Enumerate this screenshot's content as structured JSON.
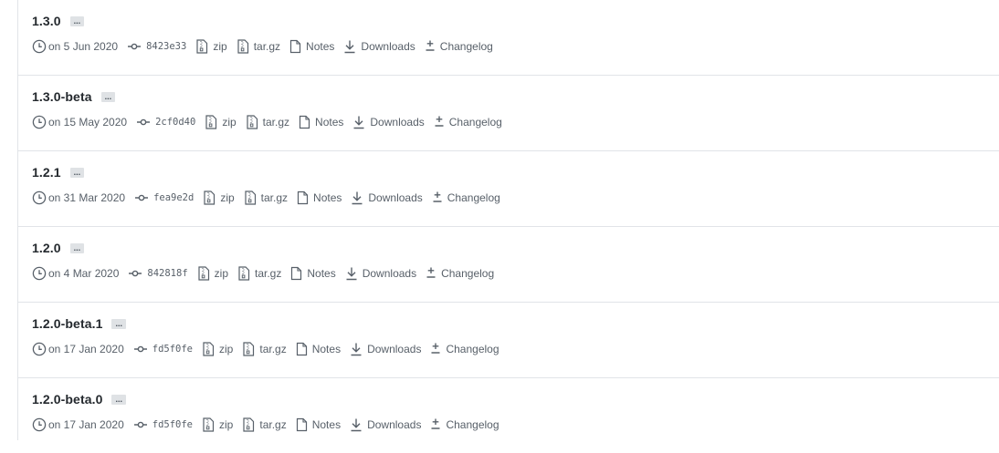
{
  "releases": [
    {
      "tag": "1.3.0",
      "ellipsis": "...",
      "date": "on 5 Jun 2020",
      "sha": "8423e33",
      "zip": "zip",
      "targz": "tar.gz",
      "notes": "Notes",
      "downloads": "Downloads",
      "changelog": "Changelog"
    },
    {
      "tag": "1.3.0-beta",
      "ellipsis": "...",
      "date": "on 15 May 2020",
      "sha": "2cf0d40",
      "zip": "zip",
      "targz": "tar.gz",
      "notes": "Notes",
      "downloads": "Downloads",
      "changelog": "Changelog"
    },
    {
      "tag": "1.2.1",
      "ellipsis": "...",
      "date": "on 31 Mar 2020",
      "sha": "fea9e2d",
      "zip": "zip",
      "targz": "tar.gz",
      "notes": "Notes",
      "downloads": "Downloads",
      "changelog": "Changelog"
    },
    {
      "tag": "1.2.0",
      "ellipsis": "...",
      "date": "on 4 Mar 2020",
      "sha": "842818f",
      "zip": "zip",
      "targz": "tar.gz",
      "notes": "Notes",
      "downloads": "Downloads",
      "changelog": "Changelog"
    },
    {
      "tag": "1.2.0-beta.1",
      "ellipsis": "...",
      "date": "on 17 Jan 2020",
      "sha": "fd5f0fe",
      "zip": "zip",
      "targz": "tar.gz",
      "notes": "Notes",
      "downloads": "Downloads",
      "changelog": "Changelog"
    },
    {
      "tag": "1.2.0-beta.0",
      "ellipsis": "...",
      "date": "on 17 Jan 2020",
      "sha": "fd5f0fe",
      "zip": "zip",
      "targz": "tar.gz",
      "notes": "Notes",
      "downloads": "Downloads",
      "changelog": "Changelog"
    }
  ],
  "icons": {
    "date": "clock-icon",
    "commit": "git-commit-icon",
    "zip": "file-zip-icon",
    "targz": "file-zip-icon",
    "notes": "file-icon",
    "downloads": "download-icon",
    "changelog": "diff-icon"
  },
  "colors": {
    "text": "#24292e",
    "muted": "#586069",
    "divider": "#e1e4e8",
    "ellipsis_bg": "#dfe2e5"
  }
}
